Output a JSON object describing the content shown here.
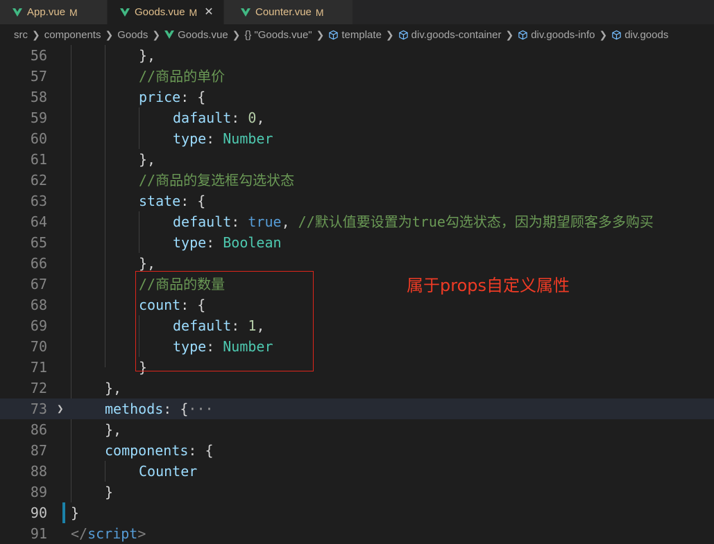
{
  "tabs": [
    {
      "name": "App.vue",
      "status": "M"
    },
    {
      "name": "Goods.vue",
      "status": "M",
      "close": "✕"
    },
    {
      "name": "Counter.vue",
      "status": "M"
    }
  ],
  "breadcrumb": {
    "items": [
      "src",
      "components",
      "Goods",
      "Goods.vue",
      "\"Goods.vue\"",
      "template",
      "div.goods-container",
      "div.goods-info",
      "div.goods"
    ],
    "braces": "{}"
  },
  "code": {
    "line_numbers": [
      "56",
      "57",
      "58",
      "59",
      "60",
      "61",
      "62",
      "63",
      "64",
      "65",
      "66",
      "67",
      "68",
      "69",
      "70",
      "71",
      "72",
      "73",
      "86",
      "87",
      "88",
      "89",
      "90",
      "91"
    ],
    "l56": "},",
    "l57": "//商品的单价",
    "l58_key": "price",
    "l58_rest": ": {",
    "l59_key": "dafault",
    "l59_colon": ": ",
    "l59_val": "0",
    "l59_end": ",",
    "l60_key": "type",
    "l60_colon": ": ",
    "l60_val": "Number",
    "l61": "},",
    "l62": "//商品的复选框勾选状态",
    "l63_key": "state",
    "l63_rest": ": {",
    "l64_key": "default",
    "l64_colon": ": ",
    "l64_val": "true",
    "l64_comma": ", ",
    "l64_comment": "//默认值要设置为true勾选状态，因为期望顾客多多购买",
    "l65_key": "type",
    "l65_colon": ": ",
    "l65_val": "Boolean",
    "l66": "},",
    "l67": "//商品的数量",
    "l68_key": "count",
    "l68_rest": ": {",
    "l69_key": "default",
    "l69_colon": ": ",
    "l69_val": "1",
    "l69_end": ",",
    "l70_key": "type",
    "l70_colon": ": ",
    "l70_val": "Number",
    "l71": "}",
    "l72": "},",
    "l73_key": "methods",
    "l73_rest": ": {",
    "l73_ellipsis": "···",
    "l86": "},",
    "l87_key": "components",
    "l87_rest": ": {",
    "l88": "Counter",
    "l89": "}",
    "l90": "}",
    "l91_open": "</",
    "l91_tag": "script",
    "l91_close": ">"
  },
  "annotation": "属于props自定义属性",
  "colors": {
    "background": "#1e1e1e",
    "key": "#9cdcfe",
    "comment": "#6a9955",
    "number": "#b5cea8",
    "keyword": "#569cd6",
    "type": "#4ec9b0",
    "modified": "#e2c08d",
    "annotation": "#ef3b25",
    "vue_green": "#41b883"
  }
}
